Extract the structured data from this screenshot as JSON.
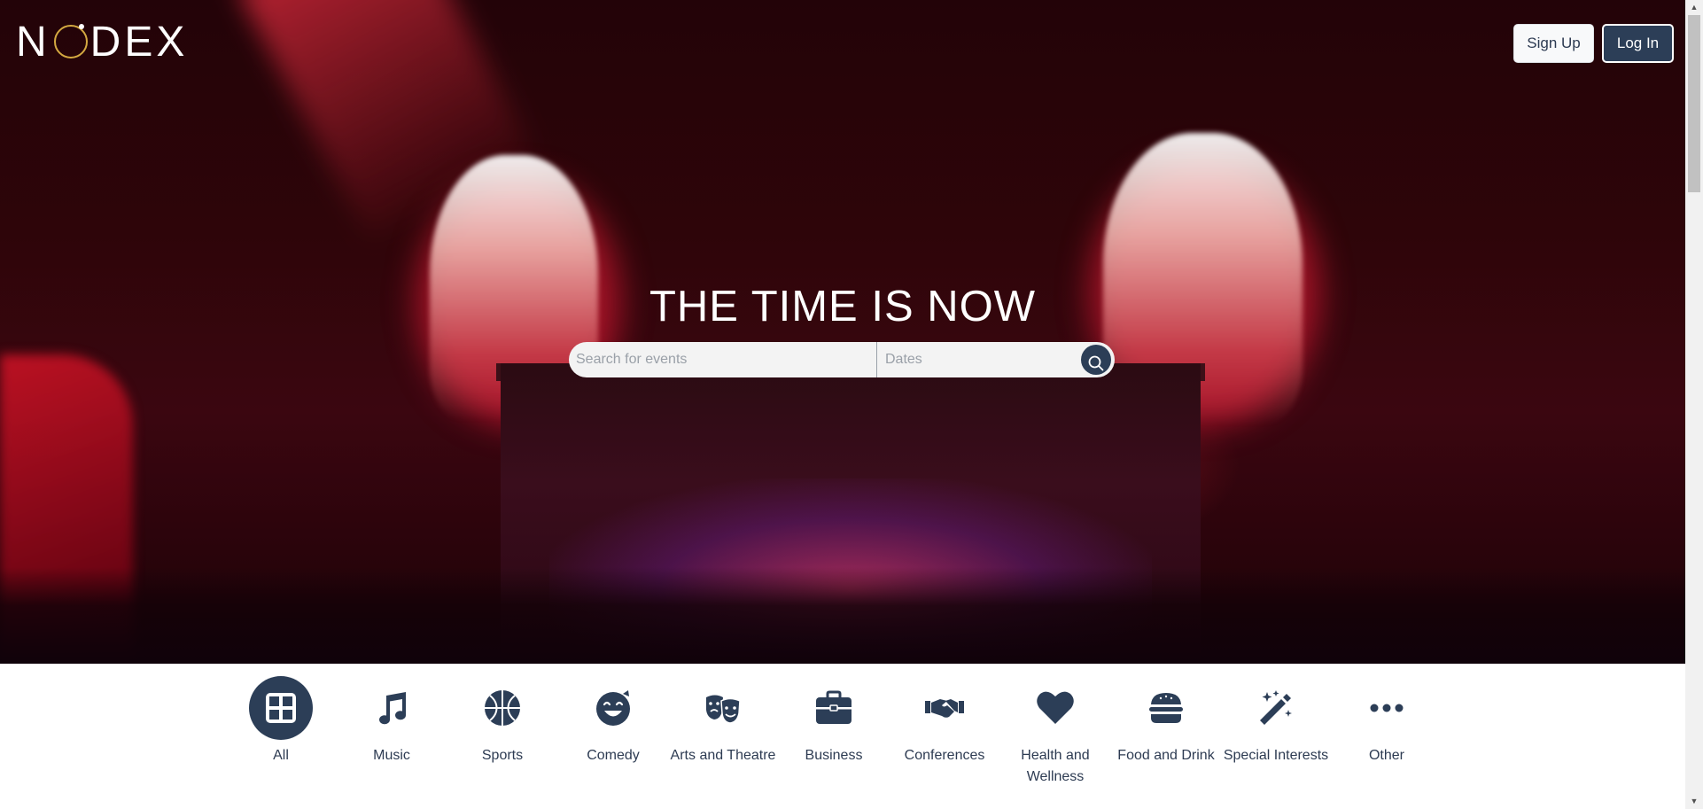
{
  "header": {
    "logo_text_left": "N",
    "logo_text_right": "DEX",
    "signup_label": "Sign Up",
    "login_label": "Log In"
  },
  "hero": {
    "headline": "THE TIME IS NOW",
    "search_placeholder": "Search for events",
    "dates_placeholder": "Dates"
  },
  "categories": [
    {
      "label": "All",
      "icon": "grid-icon",
      "selected": true
    },
    {
      "label": "Music",
      "icon": "music-note-icon",
      "selected": false
    },
    {
      "label": "Sports",
      "icon": "basketball-icon",
      "selected": false
    },
    {
      "label": "Comedy",
      "icon": "laughing-face-icon",
      "selected": false
    },
    {
      "label": "Arts and Theatre",
      "icon": "theater-masks-icon",
      "selected": false
    },
    {
      "label": "Business",
      "icon": "briefcase-icon",
      "selected": false
    },
    {
      "label": "Conferences",
      "icon": "handshake-icon",
      "selected": false
    },
    {
      "label": "Health and Wellness",
      "icon": "heart-icon",
      "selected": false
    },
    {
      "label": "Food and Drink",
      "icon": "burger-icon",
      "selected": false
    },
    {
      "label": "Special Interests",
      "icon": "magic-wand-icon",
      "selected": false
    },
    {
      "label": "Other",
      "icon": "ellipsis-icon",
      "selected": false
    }
  ],
  "colors": {
    "primary": "#2c3e57",
    "logo_accent": "#d4a941",
    "hero_red": "#e0203c"
  }
}
